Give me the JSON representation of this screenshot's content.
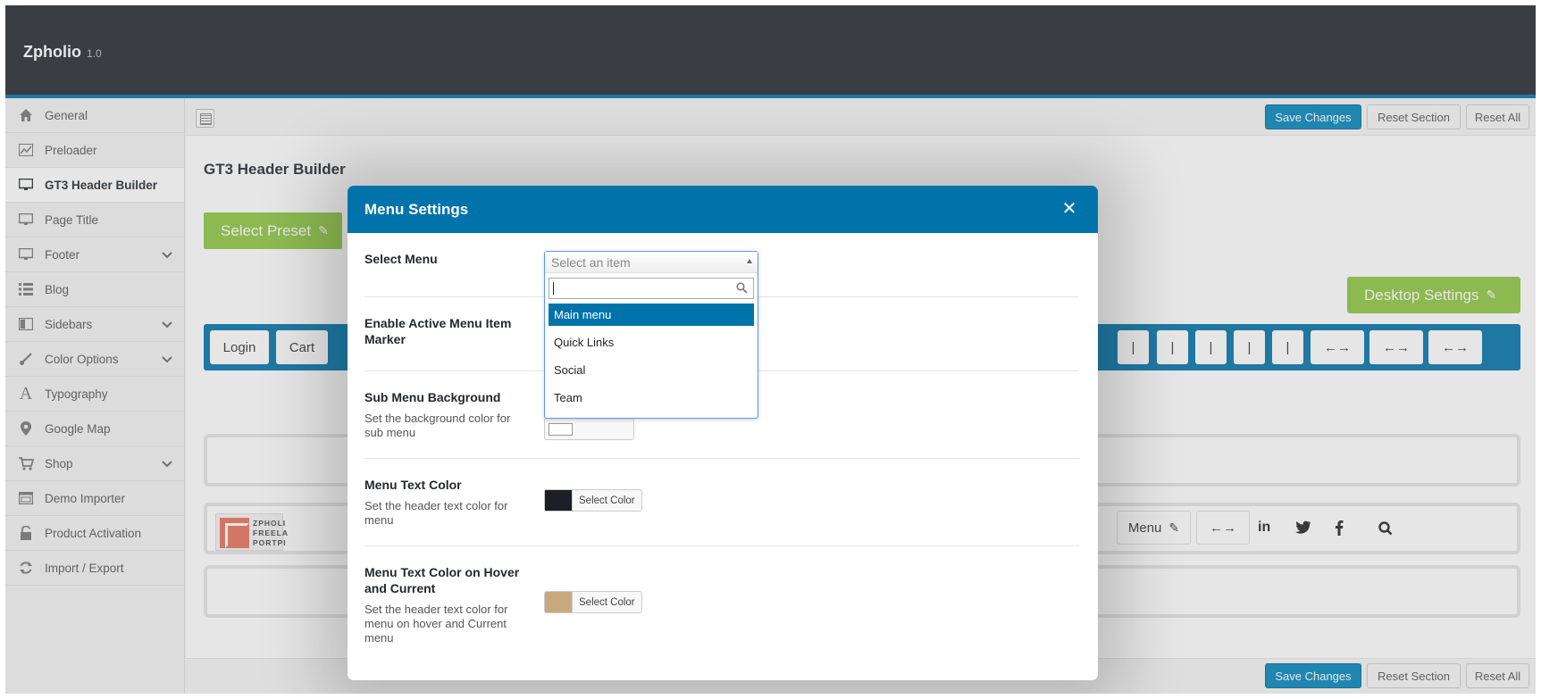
{
  "app": {
    "name": "Zpholio",
    "version": "1.0"
  },
  "sidebar": {
    "items": [
      {
        "label": "General",
        "icon": "home-icon",
        "active": false,
        "has_children": false
      },
      {
        "label": "Preloader",
        "icon": "chart-icon",
        "active": false,
        "has_children": false
      },
      {
        "label": "GT3 Header Builder",
        "icon": "monitor-icon",
        "active": true,
        "has_children": false
      },
      {
        "label": "Page Title",
        "icon": "monitor-icon",
        "active": false,
        "has_children": false
      },
      {
        "label": "Footer",
        "icon": "monitor-icon",
        "active": false,
        "has_children": true
      },
      {
        "label": "Blog",
        "icon": "list-icon",
        "active": false,
        "has_children": false
      },
      {
        "label": "Sidebars",
        "icon": "columns-icon",
        "active": false,
        "has_children": true
      },
      {
        "label": "Color Options",
        "icon": "brush-icon",
        "active": false,
        "has_children": true
      },
      {
        "label": "Typography",
        "icon": "typography-icon",
        "active": false,
        "has_children": false
      },
      {
        "label": "Google Map",
        "icon": "map-pin-icon",
        "active": false,
        "has_children": false
      },
      {
        "label": "Shop",
        "icon": "cart-icon",
        "active": false,
        "has_children": true
      },
      {
        "label": "Demo Importer",
        "icon": "window-icon",
        "active": false,
        "has_children": false
      },
      {
        "label": "Product Activation",
        "icon": "unlock-icon",
        "active": false,
        "has_children": false
      },
      {
        "label": "Import / Export",
        "icon": "refresh-icon",
        "active": false,
        "has_children": false
      }
    ]
  },
  "toolbar": {
    "save_label": "Save Changes",
    "reset_section_label": "Reset Section",
    "reset_all_label": "Reset All"
  },
  "footer_bar": {
    "save_label": "Save Changes",
    "reset_section_label": "Reset Section",
    "reset_all_label": "Reset All"
  },
  "main": {
    "title": "GT3 Header Builder",
    "select_preset_label": "Select Preset",
    "desktop_settings_label": "Desktop Settings",
    "builder_chips_left": [
      "Login",
      "Cart"
    ],
    "builder_chips_right": [
      "|",
      "|",
      "|",
      "|",
      "|",
      "←→",
      "←→",
      "←→"
    ],
    "middle_row": {
      "logo_text": "ZPHOLI\nFREELA\nPORTPI",
      "menu_label": "Menu",
      "spacer_label": "←→",
      "social_icons": [
        "linkedin-icon",
        "twitter-icon",
        "facebook-icon",
        "search-icon"
      ]
    }
  },
  "modal": {
    "title": "Menu Settings",
    "select_menu": {
      "label": "Select Menu",
      "placeholder": "Select an item",
      "search_value": "",
      "options": [
        "Main menu",
        "Quick Links",
        "Social",
        "Team"
      ],
      "highlighted": "Main menu"
    },
    "active_marker": {
      "label": "Enable Active Menu Item Marker"
    },
    "submenu_bg": {
      "label": "Sub Menu Background",
      "desc": "Set the background color for sub menu",
      "color": "#ffffff"
    },
    "menu_text_color": {
      "label": "Menu Text Color",
      "desc": "Set the header text color for menu",
      "color": "#1e1f26",
      "button": "Select Color"
    },
    "menu_hover_color": {
      "label": "Menu Text Color on Hover and Current",
      "desc": "Set the header text color for menu on hover and Current menu",
      "color": "#c8a97e",
      "button": "Select Color"
    }
  },
  "colors": {
    "header_bg": "#23282d",
    "accent": "#0073aa",
    "green": "#8cc63f"
  }
}
